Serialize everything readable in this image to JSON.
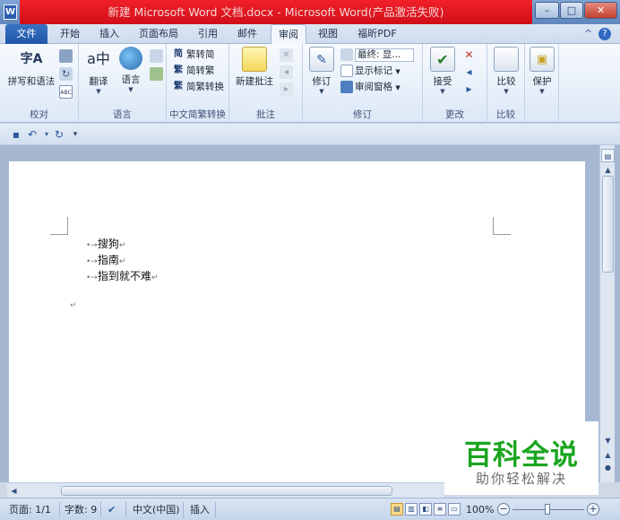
{
  "titlebar": {
    "title": "新建 Microsoft Word 文档.docx - Microsoft Word(产品激活失败)",
    "app_icon": "W",
    "minimize": "–",
    "maximize": "□",
    "close": "✕"
  },
  "tabs": {
    "file": "文件",
    "items": [
      "开始",
      "插入",
      "页面布局",
      "引用",
      "邮件",
      "审阅",
      "视图",
      "福昕PDF"
    ],
    "active": "审阅",
    "help_icon": "?",
    "collapse_icon": "^"
  },
  "ribbon": {
    "proofing": {
      "label": "校对",
      "spelling": "拼写和语法",
      "spelling_icon": "字A"
    },
    "language": {
      "label": "语言",
      "translate": "翻译",
      "language": "语言"
    },
    "chinese": {
      "label": "中文简繁转换",
      "to_simplified": "繁转简",
      "to_traditional": "简转繁",
      "convert": "简繁转换"
    },
    "comments": {
      "label": "批注",
      "new_comment": "新建批注"
    },
    "tracking": {
      "label": "修订",
      "track_changes": "修订",
      "display_final": "最终: 显...",
      "show_markup": "显示标记",
      "review_pane": "审阅窗格"
    },
    "changes": {
      "label": "更改",
      "accept": "接受"
    },
    "compare": {
      "label": "比较",
      "compare": "比较"
    },
    "protect": {
      "label": "",
      "protect": "保护"
    }
  },
  "qat": {
    "save_icon": "save-icon",
    "undo_icon": "undo-icon",
    "redo_icon": "redo-icon",
    "customize_icon": "customize-icon"
  },
  "document": {
    "bullets": [
      {
        "mark": "•→",
        "text": "搜狗",
        "end": "↵"
      },
      {
        "mark": "•→",
        "text": "指南",
        "end": "↵"
      },
      {
        "mark": "•→",
        "text": "指到就不难",
        "end": "↵"
      }
    ],
    "trailing_mark": "↵"
  },
  "watermark": {
    "title": "百科全说",
    "subtitle": "助你轻松解决"
  },
  "statusbar": {
    "page": "页面: 1/1",
    "words": "字数: 9",
    "language": "中文(中国)",
    "mode": "插入",
    "zoom": "100%",
    "zoom_out": "−",
    "zoom_in": "+"
  }
}
